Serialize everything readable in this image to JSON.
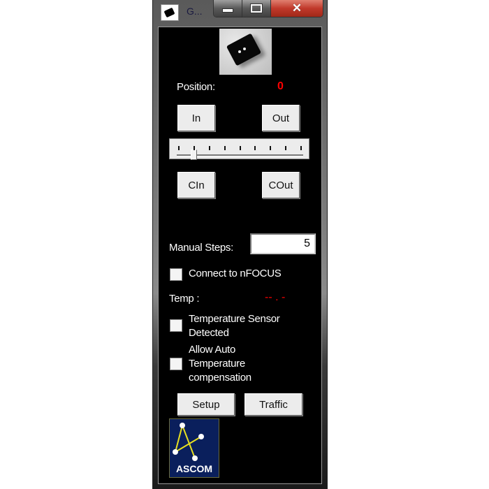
{
  "window": {
    "title": "G...",
    "controls": {
      "minimize": "minimize",
      "maximize": "maximize",
      "close": "✕"
    }
  },
  "position": {
    "label": "Position:",
    "value": "0"
  },
  "buttons": {
    "in": "In",
    "out": "Out",
    "cin": "CIn",
    "cout": "COut",
    "setup": "Setup",
    "traffic": "Traffic"
  },
  "slider": {
    "tick_count": 9,
    "value_fraction": 0.1
  },
  "manual_steps": {
    "label": "Manual Steps:",
    "value": "5"
  },
  "connect": {
    "label": "Connect to nFOCUS",
    "checked": false
  },
  "temperature": {
    "label": "Temp :",
    "value": "-- . -"
  },
  "sensor_detected": {
    "label_line1": "Temperature Sensor",
    "label_line2": "Detected",
    "checked": false
  },
  "auto_comp": {
    "label_line1": "Allow Auto",
    "label_line2": "Temperature",
    "label_line3": "compensation",
    "checked": false
  },
  "logo": {
    "text": "ASCOM"
  },
  "colors": {
    "background": "#000000",
    "value_red": "#ff0000",
    "button_face": "#ececec",
    "logo_blue": "#0a1f5c",
    "logo_lines": "#e8e020"
  }
}
